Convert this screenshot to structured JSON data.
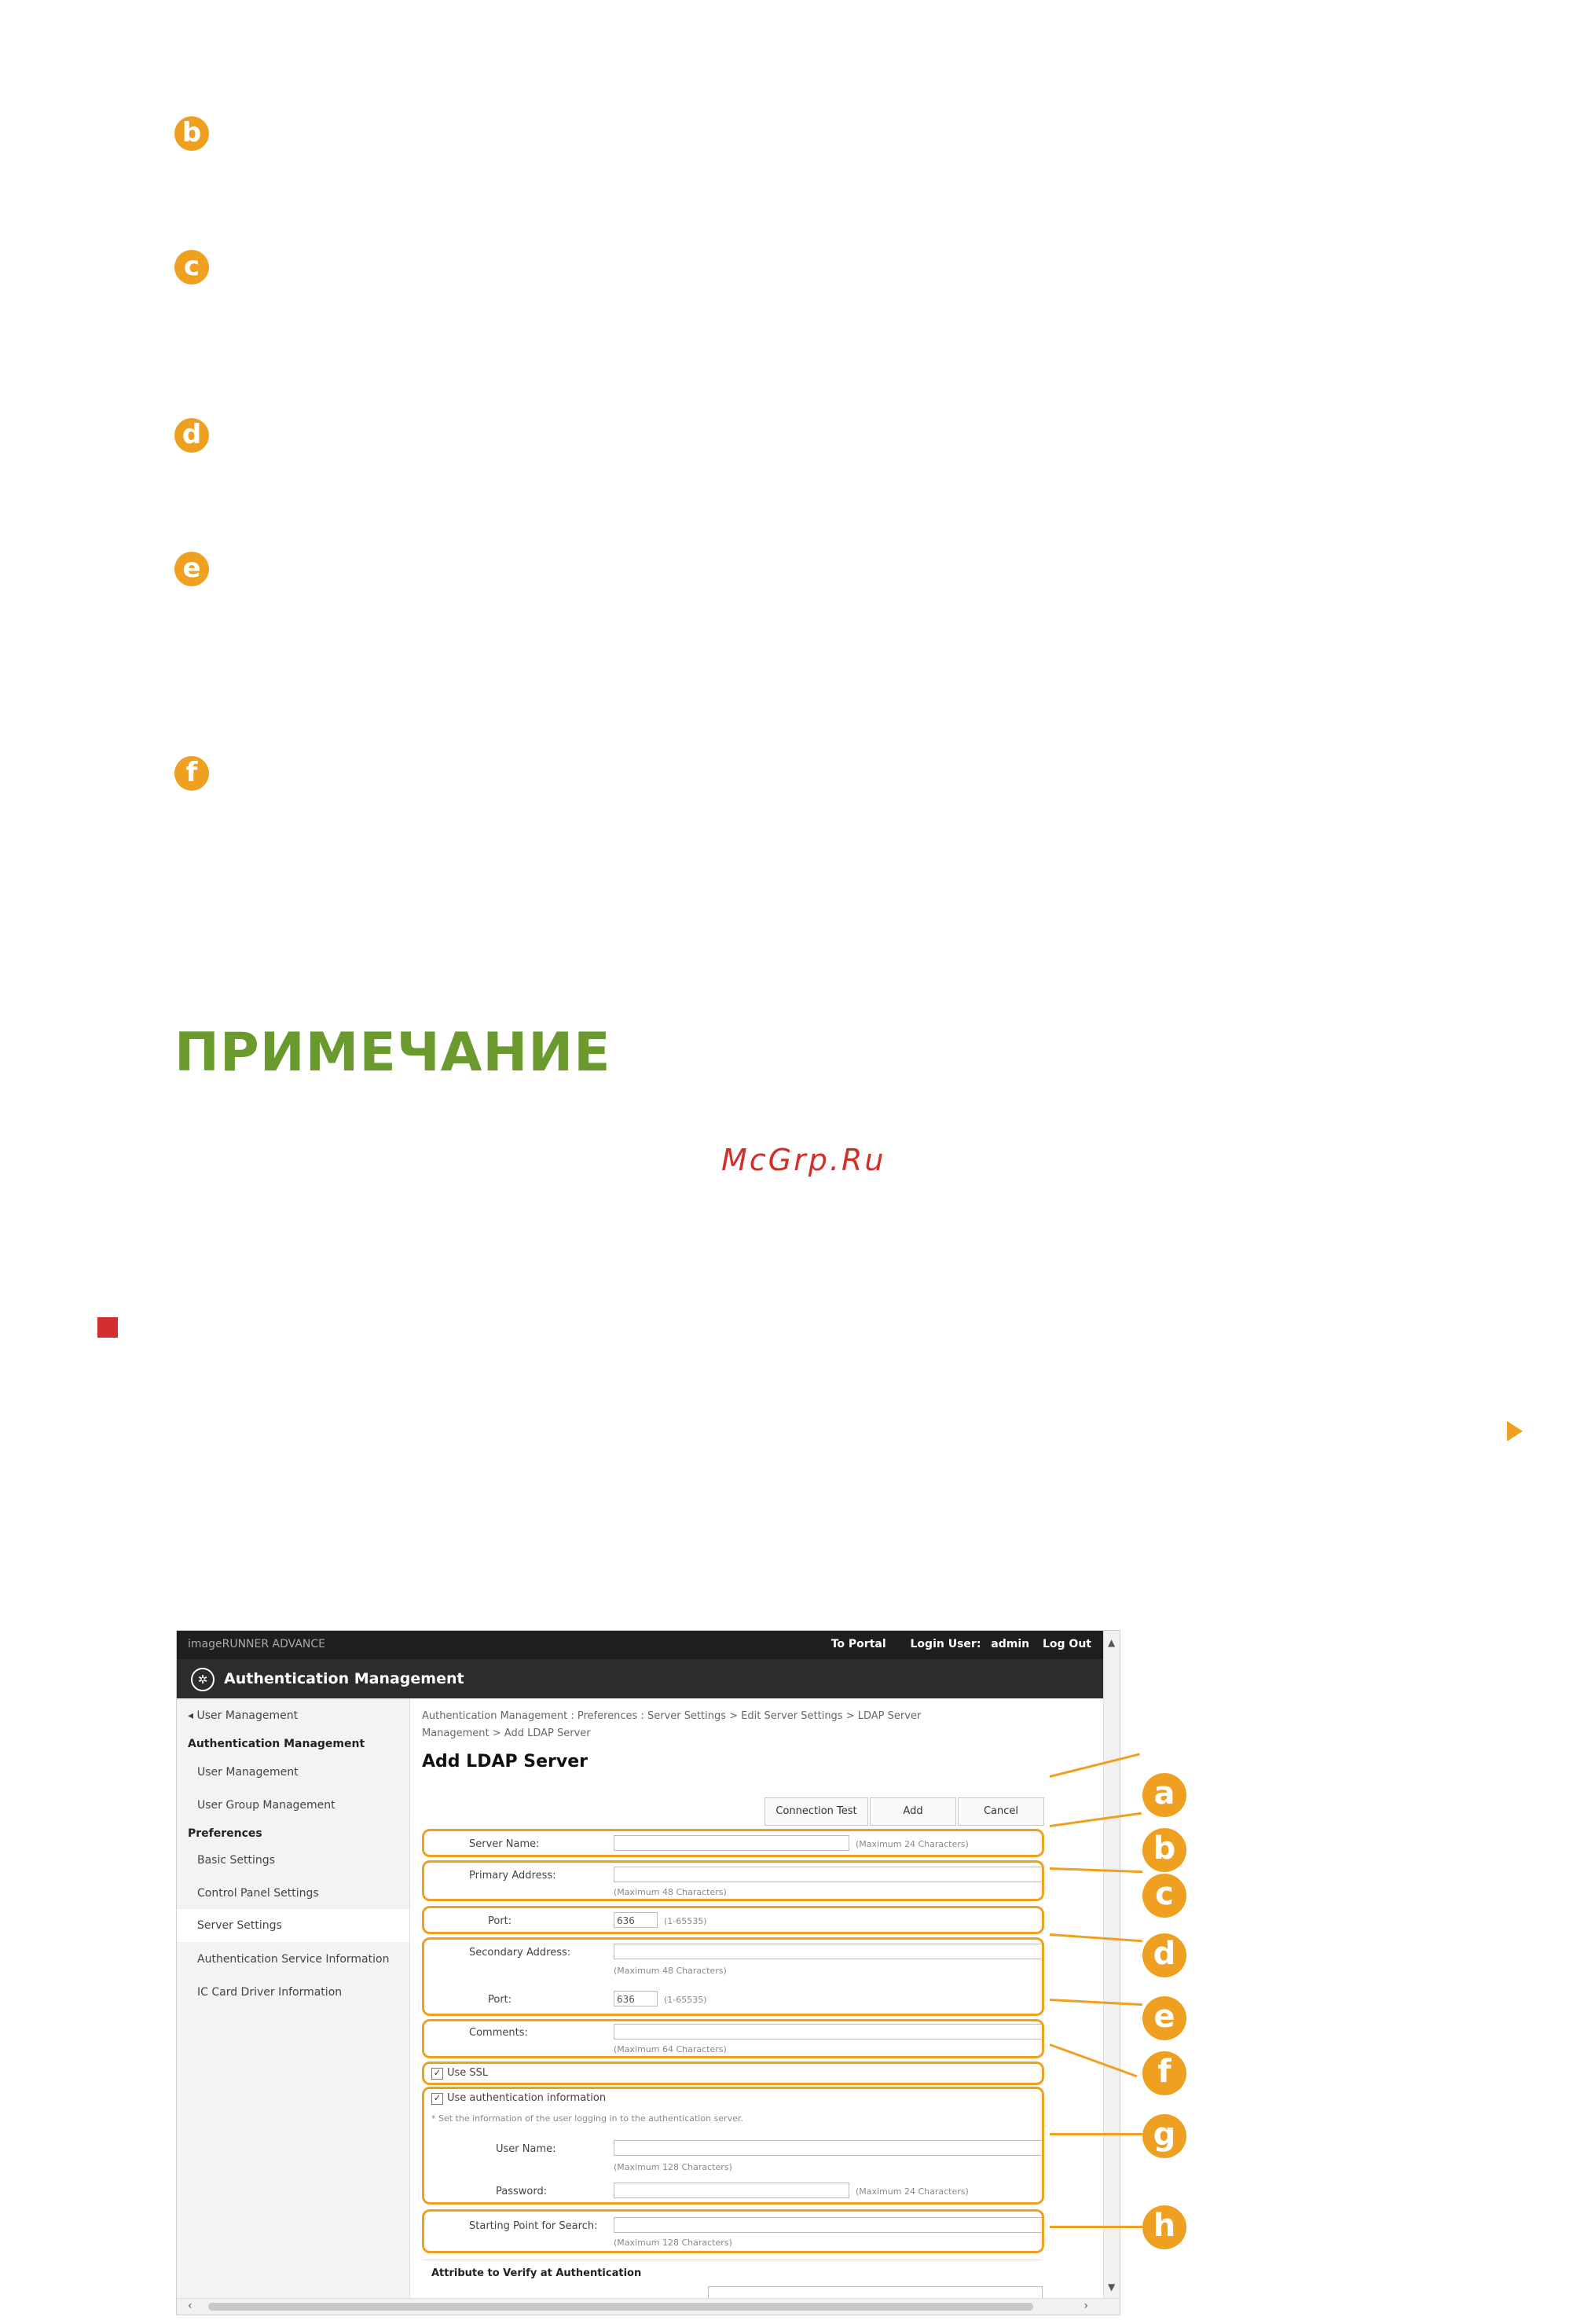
{
  "markers": [
    "b",
    "c",
    "d",
    "e",
    "f"
  ],
  "note_heading": "ПРИМЕЧАНИЕ",
  "watermark": "McGrp.Ru",
  "screenshot": {
    "top_crumb": "imageRUNNER ADVANCE",
    "to_portal": "To Portal",
    "login_user_label": "Login User:",
    "login_user": "admin",
    "log_out": "Log Out",
    "app_title": "Authentication Management",
    "sidebar": {
      "back": "User Management",
      "section1": "Authentication Management",
      "user_mgmt": "User Management",
      "group_mgmt": "User Group Management",
      "section2": "Preferences",
      "basic": "Basic Settings",
      "control_panel": "Control Panel Settings",
      "server": "Server Settings",
      "auth_service": "Authentication Service Information",
      "ic_card": "IC Card Driver Information"
    },
    "breadcrumb_line1": "Authentication Management : Preferences : Server Settings > Edit Server Settings > LDAP Server",
    "breadcrumb_line2": "Management > Add LDAP Server",
    "page_title": "Add LDAP Server",
    "buttons": {
      "connection_test": "Connection Test",
      "add": "Add",
      "cancel": "Cancel"
    },
    "form": {
      "server_name": "Server Name:",
      "server_name_hint": "(Maximum 24 Characters)",
      "primary_address": "Primary Address:",
      "primary_address_hint": "(Maximum 48 Characters)",
      "port": "Port:",
      "port_value": "636",
      "port_hint": "(1-65535)",
      "secondary_address": "Secondary Address:",
      "secondary_address_hint": "(Maximum 48 Characters)",
      "port2": "Port:",
      "port2_value": "636",
      "port2_hint": "(1-65535)",
      "comments": "Comments:",
      "comments_hint": "(Maximum 64 Characters)",
      "use_ssl": "Use SSL",
      "use_auth_info": "Use authentication information",
      "auth_note": "* Set the information of the user logging in to the authentication server.",
      "user_name": "User Name:",
      "user_name_hint": "(Maximum 128 Characters)",
      "password": "Password:",
      "password_hint": "(Maximum 24 Characters)",
      "starting_point": "Starting Point for Search:",
      "starting_point_hint": "(Maximum 128 Characters)",
      "attribute_section": "Attribute to Verify at Authentication"
    },
    "callouts": [
      "a",
      "b",
      "c",
      "d",
      "e",
      "f",
      "g",
      "h"
    ]
  },
  "colors": {
    "accent": "#f0a020",
    "heading": "#6a9a2e",
    "bullet": "#d32f2f"
  }
}
